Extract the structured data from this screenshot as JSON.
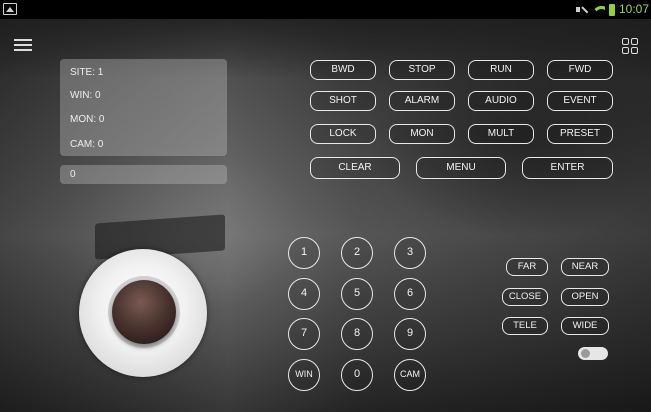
{
  "status_bar": {
    "time": "10:07",
    "icons": [
      "image-notification-icon",
      "mute-icon",
      "wifi-icon",
      "battery-icon"
    ]
  },
  "colors": {
    "status_time": "#9bd44a",
    "button_border": "#e8e8e8",
    "joystick_knob": "#4c3530"
  },
  "info": {
    "site": "SITE: 1",
    "win": "WIN: 0",
    "mon": "MON: 0",
    "cam": "CAM: 0",
    "input_value": "0"
  },
  "commands": {
    "row1": [
      "BWD",
      "STOP",
      "RUN",
      "FWD"
    ],
    "row2": [
      "SHOT",
      "ALARM",
      "AUDIO",
      "EVENT"
    ],
    "row3": [
      "LOCK",
      "MON",
      "MULT",
      "PRESET"
    ],
    "row4": [
      "CLEAR",
      "MENU",
      "ENTER"
    ]
  },
  "keypad": [
    "1",
    "2",
    "3",
    "4",
    "5",
    "6",
    "7",
    "8",
    "9",
    "WIN",
    "0",
    "CAM"
  ],
  "lens": {
    "far": "FAR",
    "near": "NEAR",
    "close": "CLOSE",
    "open": "OPEN",
    "tele": "TELE",
    "wide": "WIDE"
  },
  "toggle": {
    "state": "off"
  }
}
